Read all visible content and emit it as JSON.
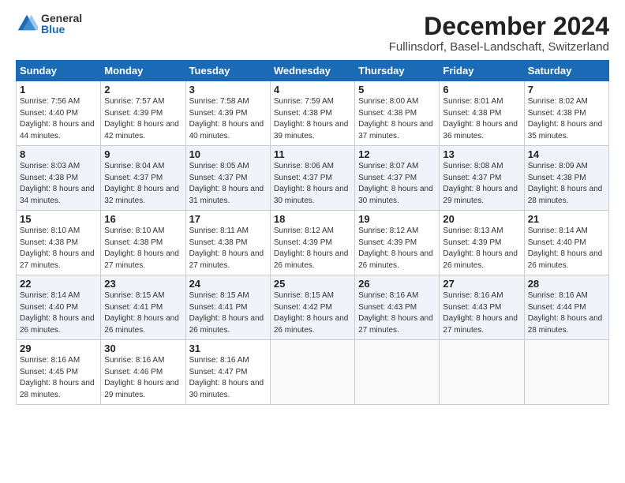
{
  "logo": {
    "general": "General",
    "blue": "Blue"
  },
  "header": {
    "title": "December 2024",
    "subtitle": "Fullinsdorf, Basel-Landschaft, Switzerland"
  },
  "weekdays": [
    "Sunday",
    "Monday",
    "Tuesday",
    "Wednesday",
    "Thursday",
    "Friday",
    "Saturday"
  ],
  "weeks": [
    [
      {
        "day": "1",
        "sunrise": "7:56 AM",
        "sunset": "4:40 PM",
        "daylight": "8 hours and 44 minutes."
      },
      {
        "day": "2",
        "sunrise": "7:57 AM",
        "sunset": "4:39 PM",
        "daylight": "8 hours and 42 minutes."
      },
      {
        "day": "3",
        "sunrise": "7:58 AM",
        "sunset": "4:39 PM",
        "daylight": "8 hours and 40 minutes."
      },
      {
        "day": "4",
        "sunrise": "7:59 AM",
        "sunset": "4:38 PM",
        "daylight": "8 hours and 39 minutes."
      },
      {
        "day": "5",
        "sunrise": "8:00 AM",
        "sunset": "4:38 PM",
        "daylight": "8 hours and 37 minutes."
      },
      {
        "day": "6",
        "sunrise": "8:01 AM",
        "sunset": "4:38 PM",
        "daylight": "8 hours and 36 minutes."
      },
      {
        "day": "7",
        "sunrise": "8:02 AM",
        "sunset": "4:38 PM",
        "daylight": "8 hours and 35 minutes."
      }
    ],
    [
      {
        "day": "8",
        "sunrise": "8:03 AM",
        "sunset": "4:38 PM",
        "daylight": "8 hours and 34 minutes."
      },
      {
        "day": "9",
        "sunrise": "8:04 AM",
        "sunset": "4:37 PM",
        "daylight": "8 hours and 32 minutes."
      },
      {
        "day": "10",
        "sunrise": "8:05 AM",
        "sunset": "4:37 PM",
        "daylight": "8 hours and 31 minutes."
      },
      {
        "day": "11",
        "sunrise": "8:06 AM",
        "sunset": "4:37 PM",
        "daylight": "8 hours and 30 minutes."
      },
      {
        "day": "12",
        "sunrise": "8:07 AM",
        "sunset": "4:37 PM",
        "daylight": "8 hours and 30 minutes."
      },
      {
        "day": "13",
        "sunrise": "8:08 AM",
        "sunset": "4:37 PM",
        "daylight": "8 hours and 29 minutes."
      },
      {
        "day": "14",
        "sunrise": "8:09 AM",
        "sunset": "4:38 PM",
        "daylight": "8 hours and 28 minutes."
      }
    ],
    [
      {
        "day": "15",
        "sunrise": "8:10 AM",
        "sunset": "4:38 PM",
        "daylight": "8 hours and 27 minutes."
      },
      {
        "day": "16",
        "sunrise": "8:10 AM",
        "sunset": "4:38 PM",
        "daylight": "8 hours and 27 minutes."
      },
      {
        "day": "17",
        "sunrise": "8:11 AM",
        "sunset": "4:38 PM",
        "daylight": "8 hours and 27 minutes."
      },
      {
        "day": "18",
        "sunrise": "8:12 AM",
        "sunset": "4:39 PM",
        "daylight": "8 hours and 26 minutes."
      },
      {
        "day": "19",
        "sunrise": "8:12 AM",
        "sunset": "4:39 PM",
        "daylight": "8 hours and 26 minutes."
      },
      {
        "day": "20",
        "sunrise": "8:13 AM",
        "sunset": "4:39 PM",
        "daylight": "8 hours and 26 minutes."
      },
      {
        "day": "21",
        "sunrise": "8:14 AM",
        "sunset": "4:40 PM",
        "daylight": "8 hours and 26 minutes."
      }
    ],
    [
      {
        "day": "22",
        "sunrise": "8:14 AM",
        "sunset": "4:40 PM",
        "daylight": "8 hours and 26 minutes."
      },
      {
        "day": "23",
        "sunrise": "8:15 AM",
        "sunset": "4:41 PM",
        "daylight": "8 hours and 26 minutes."
      },
      {
        "day": "24",
        "sunrise": "8:15 AM",
        "sunset": "4:41 PM",
        "daylight": "8 hours and 26 minutes."
      },
      {
        "day": "25",
        "sunrise": "8:15 AM",
        "sunset": "4:42 PM",
        "daylight": "8 hours and 26 minutes."
      },
      {
        "day": "26",
        "sunrise": "8:16 AM",
        "sunset": "4:43 PM",
        "daylight": "8 hours and 27 minutes."
      },
      {
        "day": "27",
        "sunrise": "8:16 AM",
        "sunset": "4:43 PM",
        "daylight": "8 hours and 27 minutes."
      },
      {
        "day": "28",
        "sunrise": "8:16 AM",
        "sunset": "4:44 PM",
        "daylight": "8 hours and 28 minutes."
      }
    ],
    [
      {
        "day": "29",
        "sunrise": "8:16 AM",
        "sunset": "4:45 PM",
        "daylight": "8 hours and 28 minutes."
      },
      {
        "day": "30",
        "sunrise": "8:16 AM",
        "sunset": "4:46 PM",
        "daylight": "8 hours and 29 minutes."
      },
      {
        "day": "31",
        "sunrise": "8:16 AM",
        "sunset": "4:47 PM",
        "daylight": "8 hours and 30 minutes."
      },
      null,
      null,
      null,
      null
    ]
  ]
}
